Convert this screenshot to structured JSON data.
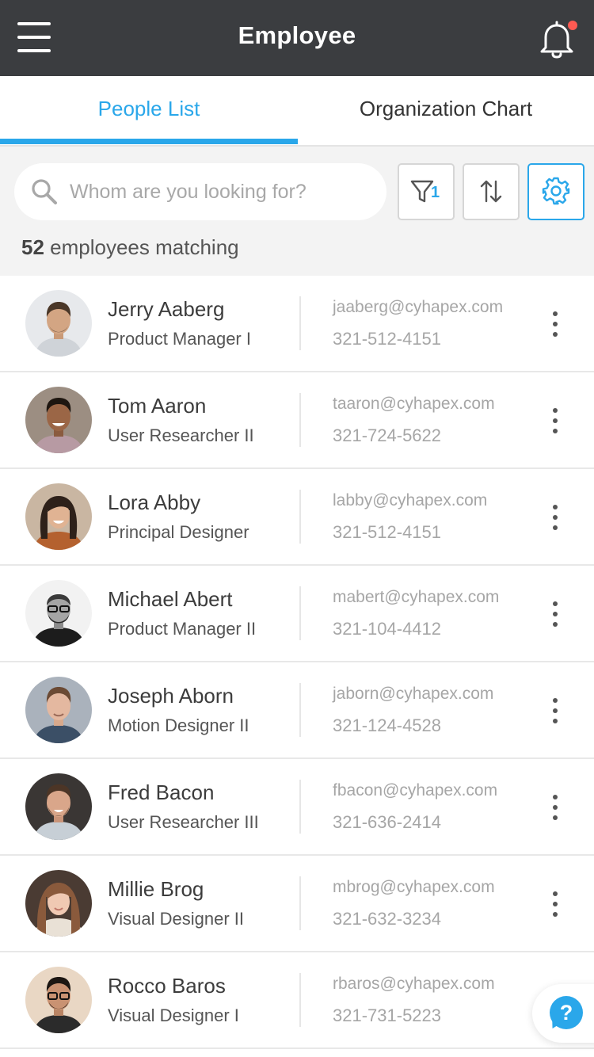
{
  "header": {
    "title": "Employee",
    "has_notification": true
  },
  "tabs": [
    {
      "label": "People List",
      "active": true
    },
    {
      "label": "Organization Chart",
      "active": false
    }
  ],
  "search": {
    "placeholder": "Whom are you looking for?",
    "value": ""
  },
  "toolbar": {
    "filter_count": "1",
    "settings_active": true
  },
  "results": {
    "count": "52",
    "label": "employees matching"
  },
  "colors": {
    "accent": "#2aa7ea",
    "header_bg": "#3b3d40",
    "notification_dot": "#ff5a52"
  },
  "employees": [
    {
      "name": "Jerry Aaberg",
      "role": "Product Manager I",
      "email": "jaaberg@cyhapex.com",
      "phone": "321-512-4151"
    },
    {
      "name": "Tom Aaron",
      "role": "User Researcher II",
      "email": "taaron@cyhapex.com",
      "phone": "321-724-5622"
    },
    {
      "name": "Lora Abby",
      "role": "Principal Designer",
      "email": "labby@cyhapex.com",
      "phone": "321-512-4151"
    },
    {
      "name": "Michael Abert",
      "role": "Product Manager II",
      "email": "mabert@cyhapex.com",
      "phone": "321-104-4412"
    },
    {
      "name": "Joseph Aborn",
      "role": "Motion Designer II",
      "email": "jaborn@cyhapex.com",
      "phone": "321-124-4528"
    },
    {
      "name": "Fred Bacon",
      "role": "User Researcher III",
      "email": "fbacon@cyhapex.com",
      "phone": "321-636-2414"
    },
    {
      "name": "Millie Brog",
      "role": "Visual Designer II",
      "email": "mbrog@cyhapex.com",
      "phone": "321-632-3234"
    },
    {
      "name": "Rocco Baros",
      "role": "Visual Designer I",
      "email": "rbaros@cyhapex.com",
      "phone": "321-731-5223"
    }
  ],
  "help": {
    "label": "?"
  }
}
